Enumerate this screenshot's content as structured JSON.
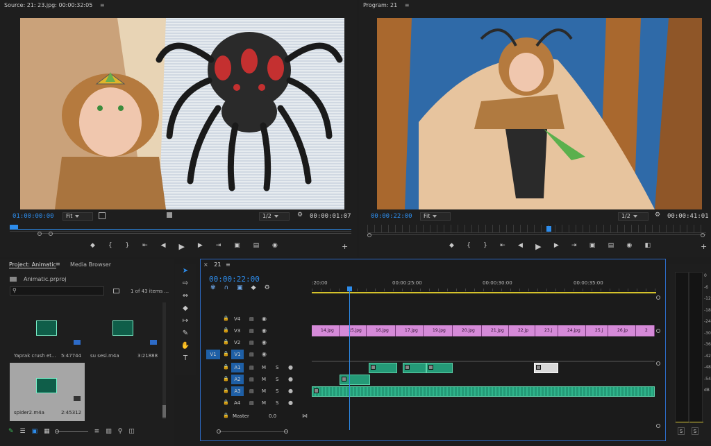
{
  "source": {
    "title": "Source: 21: 23.jpg: 00:00:32:05",
    "menu": "≡",
    "timecode_left": "01:00:00:00",
    "fit": "Fit",
    "resolution": "1/2",
    "timecode_right": "00:00:01:07"
  },
  "program": {
    "title": "Program: 21",
    "menu": "≡",
    "timecode_left": "00:00:22:00",
    "fit": "Fit",
    "resolution": "1/2",
    "timecode_right": "00:00:41:01"
  },
  "project": {
    "tab_project": "Project: Animatic",
    "tab_media": "Media Browser",
    "file": "Animatic.prproj",
    "search_placeholder": "",
    "count": "1 of 43 items ...",
    "items": [
      {
        "name": "Yaprak crush et...",
        "duration": "5:47744"
      },
      {
        "name": "su sesi.m4a",
        "duration": "3:21888"
      },
      {
        "name": "spider2.m4a",
        "duration": "2:45312"
      }
    ]
  },
  "timeline": {
    "tab": "21",
    "timecode": "00:00:22:00",
    "ruler": [
      ":20:00",
      "00:00:25:00",
      "00:00:30:00",
      "00:00:35:00"
    ],
    "video_tracks": [
      "V4",
      "V3",
      "V2",
      "V1"
    ],
    "audio_tracks": [
      "A1",
      "A2",
      "A3",
      "A4"
    ],
    "source_patch_v": "V1",
    "master_label": "Master",
    "master_value": "0.0",
    "mute_label": "M",
    "solo_label": "S",
    "v3_clips": [
      "14.jpg",
      "15.jpg",
      "16.jpg",
      "17.jpg",
      "19.jpg",
      "20.jpg",
      "21.jpg",
      "22.jp",
      "23.j",
      "24.jpg",
      "25.j",
      "26.jp",
      "2"
    ]
  },
  "meter": {
    "scale": [
      "0",
      "-6",
      "-12",
      "-18",
      "-24",
      "-30",
      "-36",
      "-42",
      "-48",
      "-54",
      "dB"
    ],
    "solo_left": "S",
    "solo_right": "S"
  },
  "colors": {
    "accent": "#2d8ceb",
    "video_clip": "#d58ad8",
    "audio_clip": "#249a77",
    "playhead": "#2d8ceb"
  }
}
